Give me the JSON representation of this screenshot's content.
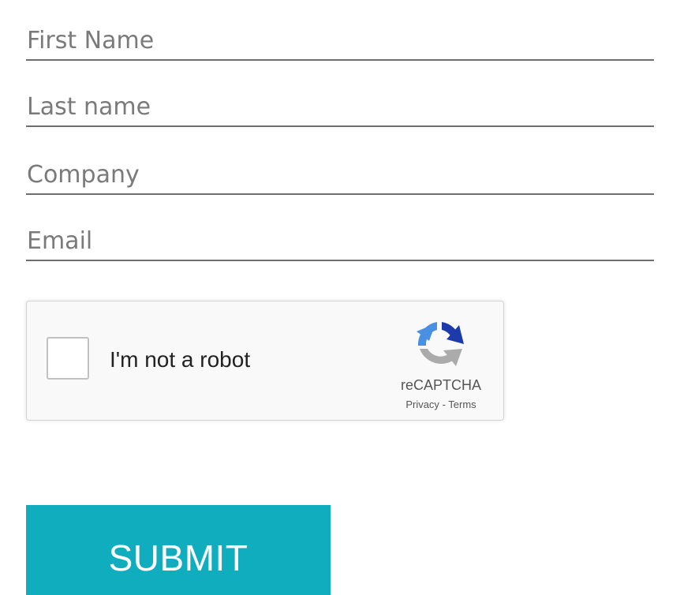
{
  "form": {
    "fields": {
      "first_name": {
        "placeholder": "First Name",
        "value": ""
      },
      "last_name": {
        "placeholder": "Last name",
        "value": ""
      },
      "company": {
        "placeholder": "Company",
        "value": ""
      },
      "email": {
        "placeholder": "Email",
        "value": ""
      }
    },
    "captcha": {
      "label": "I'm not a robot",
      "checked": false,
      "brand": "reCAPTCHA",
      "privacy_link": "Privacy",
      "separator": "-",
      "terms_link": "Terms",
      "logo_icon": "recaptcha-logo-icon"
    },
    "submit_label": "SUBMIT"
  },
  "colors": {
    "accent": "#0fadbd",
    "underline": "#6f6f6f",
    "placeholder": "#7a7a7a",
    "captcha_bg": "#f9f9f9",
    "captcha_border": "#d3d3d3",
    "logo_blue": "#1c3aa9",
    "logo_light_blue": "#4a90e2",
    "logo_gray": "#ababab"
  }
}
